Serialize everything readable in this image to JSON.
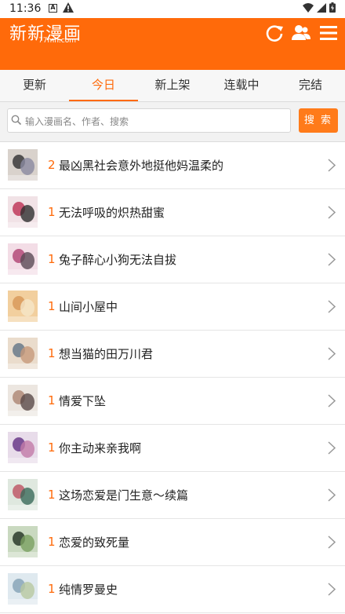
{
  "status_bar": {
    "time": "11:36",
    "left_icons": [
      "a-box-icon",
      "warning-icon"
    ],
    "right_icons": [
      "wifi-icon",
      "signal-icon",
      "battery-icon"
    ]
  },
  "header": {
    "logo_text": "新新漫画",
    "logo_domain": "77mh.com",
    "bg_color": "#ff6a0a",
    "icons": [
      "refresh-icon",
      "user-icon",
      "menu-icon"
    ]
  },
  "tabs": [
    {
      "label": "更新",
      "active": false
    },
    {
      "label": "今日",
      "active": true
    },
    {
      "label": "新上架",
      "active": false
    },
    {
      "label": "连载中",
      "active": false
    },
    {
      "label": "完结",
      "active": false
    }
  ],
  "search": {
    "placeholder": "输入漫画名、作者、搜索",
    "button": "搜 索"
  },
  "items": [
    {
      "rank": "2",
      "title": "最凶黑社会意外地挺他妈温柔的",
      "cover": [
        "#d9d2cc",
        "#3a3a3a",
        "#8a8aa0"
      ]
    },
    {
      "rank": "1",
      "title": "无法呼吸的炽热甜蜜",
      "cover": [
        "#f1e2e6",
        "#c03a5a",
        "#303030"
      ]
    },
    {
      "rank": "1",
      "title": "兔子醉心小狗无法自拔",
      "cover": [
        "#f3dde6",
        "#b34a78",
        "#5a4a55"
      ]
    },
    {
      "rank": "1",
      "title": "山间小屋中",
      "cover": [
        "#f2cf9e",
        "#d99a5a",
        "#f5e6c8"
      ]
    },
    {
      "rank": "1",
      "title": "想当猫的田万川君",
      "cover": [
        "#eadccc",
        "#6a7a8a",
        "#c79a7a"
      ]
    },
    {
      "rank": "1",
      "title": "情爱下坠",
      "cover": [
        "#ece6e0",
        "#b08a78",
        "#5a4a48"
      ]
    },
    {
      "rank": "1",
      "title": "你主动来亲我啊",
      "cover": [
        "#e8dcea",
        "#6a3a8a",
        "#c27aa8"
      ]
    },
    {
      "rank": "1",
      "title": "这场恋爱是门生意～续篇",
      "cover": [
        "#dfe8df",
        "#c05a6a",
        "#3a6a5a"
      ]
    },
    {
      "rank": "1",
      "title": "恋爱的致死量",
      "cover": [
        "#c9d9c0",
        "#2a3a2a",
        "#7aa060"
      ]
    },
    {
      "rank": "1",
      "title": "纯情罗曼史",
      "cover": [
        "#dfe9ef",
        "#8aa6b8",
        "#b8c8a0"
      ]
    }
  ]
}
